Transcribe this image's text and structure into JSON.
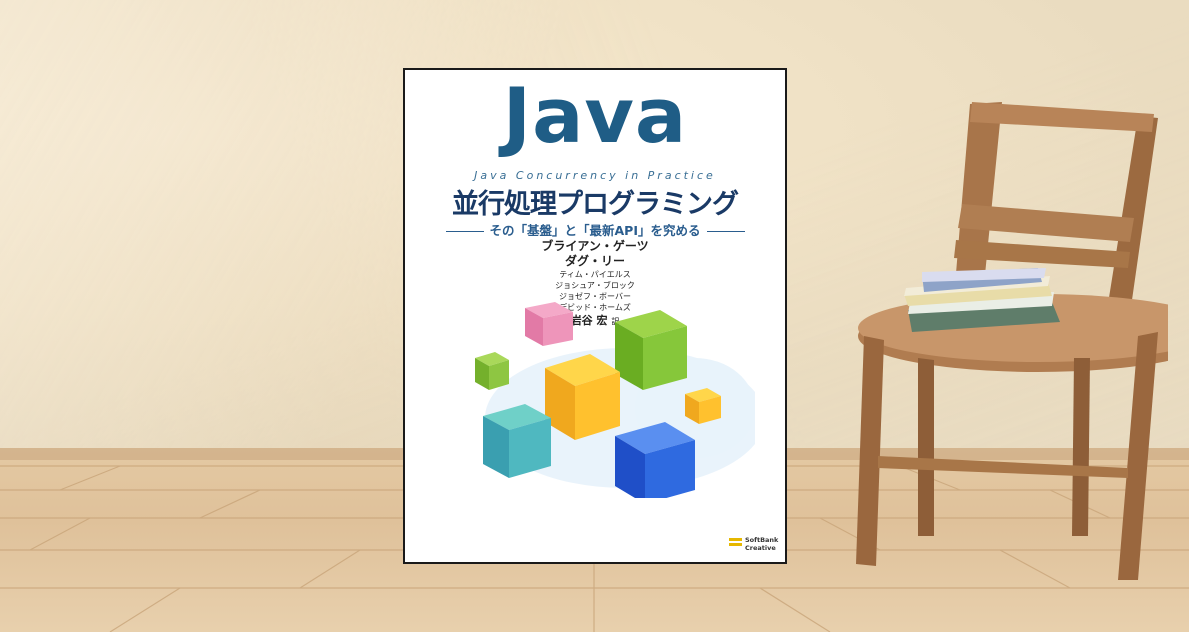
{
  "book": {
    "title_main": "Java",
    "title_en": "Java Concurrency in Practice",
    "title_jp": "並行処理プログラミング",
    "subtitle_jp": "その「基盤」と「最新API」を究める",
    "authors": [
      "ブライアン・ゲーツ",
      "ダグ・リー",
      "ティム・パイエルス",
      "ジョシュア・ブロック",
      "ジョゼフ・ボーバー",
      "デビッド・ホームズ"
    ],
    "translator": "岩谷 宏",
    "translator_suffix": "訳",
    "publisher_line1": "SoftBank",
    "publisher_line2": "Creative"
  },
  "colors": {
    "title_blue": "#1f5d86",
    "wall": "#f1e3c7",
    "floor": "#dfc19a"
  }
}
